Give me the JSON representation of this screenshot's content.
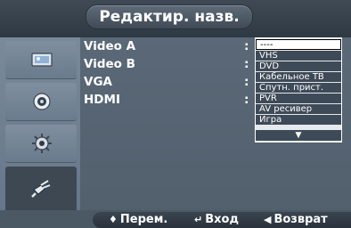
{
  "window": {
    "title": "Редактир. назв."
  },
  "sidebar": {
    "items": [
      {
        "icon": "picture-icon",
        "active": false
      },
      {
        "icon": "sound-icon",
        "active": false
      },
      {
        "icon": "settings-gear-icon",
        "active": false
      },
      {
        "icon": "input-plug-icon",
        "active": true
      }
    ]
  },
  "sources": [
    {
      "name": "Video A",
      "colon": ":"
    },
    {
      "name": "Video B",
      "colon": ":"
    },
    {
      "name": "VGA",
      "colon": ":"
    },
    {
      "name": "HDMI",
      "colon": ":"
    }
  ],
  "dropdown": {
    "selected": "----",
    "options": [
      "----",
      "VHS",
      "DVD",
      "Кабельное ТВ",
      "Спутн. прист.",
      "PVR",
      "AV ресивер",
      "Игра"
    ],
    "more_indicator": "▼"
  },
  "hints": {
    "move": "Перем.",
    "enter": "Вход",
    "return": "Возврат",
    "move_icon": "♦",
    "enter_icon": "↵",
    "return_icon": "◀"
  }
}
